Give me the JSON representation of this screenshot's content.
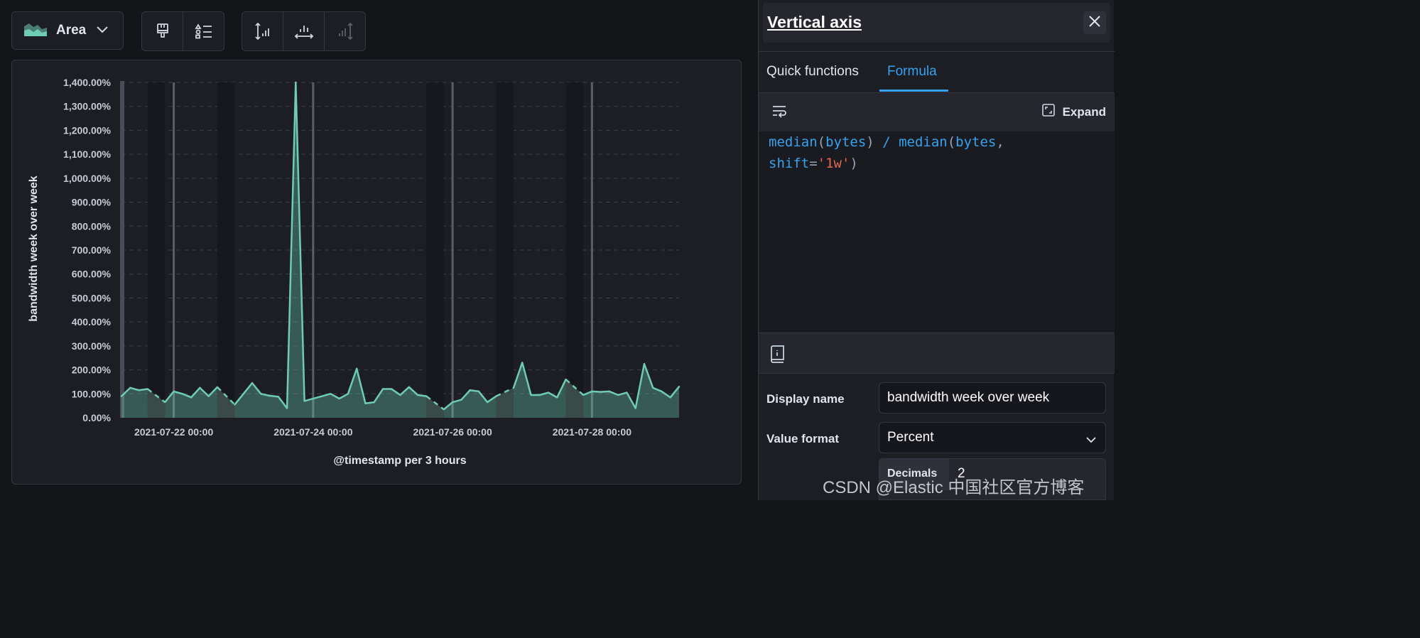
{
  "toolbar": {
    "chart_type_label": "Area",
    "chart_type_icon": "area-chart-icon",
    "style_buttons": [
      "paintbrush-icon",
      "legend-list-icon"
    ],
    "axis_buttons": [
      "left-axis-icon",
      "bottom-axis-icon",
      "right-axis-icon"
    ]
  },
  "chart": {
    "y_axis_title": "bandwidth week over week",
    "x_axis_title": "@timestamp per 3 hours",
    "area_color": "#6dccb1",
    "y_ticks": [
      "0.00%",
      "100.00%",
      "200.00%",
      "300.00%",
      "400.00%",
      "500.00%",
      "600.00%",
      "700.00%",
      "800.00%",
      "900.00%",
      "1,000.00%",
      "1,100.00%",
      "1,200.00%",
      "1,300.00%",
      "1,400.00%"
    ],
    "x_ticks": [
      "2021-07-22 00:00",
      "2021-07-24 00:00",
      "2021-07-26 00:00",
      "2021-07-28 00:00"
    ]
  },
  "chart_data": {
    "type": "area",
    "x_unit": "3-hour buckets from 2021-07-21 06:00",
    "xlabel": "@timestamp per 3 hours",
    "ylabel": "bandwidth week over week",
    "ylim": [
      0,
      1400
    ],
    "y_format": "percent",
    "grid": "horizontal dashed",
    "x": [
      0,
      1,
      2,
      3,
      4,
      5,
      6,
      7,
      8,
      9,
      10,
      11,
      12,
      13,
      14,
      15,
      16,
      17,
      18,
      19,
      20,
      21,
      22,
      23,
      24,
      25,
      26,
      27,
      28,
      29,
      30,
      31,
      32,
      33,
      34,
      35,
      36,
      37,
      38,
      39,
      40,
      41,
      42,
      43,
      44,
      45,
      46,
      47,
      48,
      49,
      50,
      51,
      52,
      53,
      54,
      55,
      56,
      57,
      58,
      59,
      60,
      61,
      62,
      63,
      64
    ],
    "values": [
      90,
      125,
      115,
      120,
      null,
      65,
      110,
      100,
      85,
      125,
      90,
      128,
      null,
      55,
      100,
      145,
      100,
      92,
      88,
      40,
      1400,
      70,
      80,
      90,
      100,
      80,
      100,
      205,
      60,
      65,
      120,
      120,
      95,
      128,
      95,
      90,
      null,
      35,
      65,
      75,
      115,
      110,
      65,
      90,
      null,
      125,
      230,
      95,
      95,
      105,
      85,
      160,
      null,
      95,
      110,
      108,
      110,
      95,
      105,
      40,
      225,
      125,
      110,
      85,
      130
    ],
    "dashed_gaps_after": [
      3,
      11,
      35,
      43,
      51
    ]
  },
  "flyout": {
    "title": "Vertical axis",
    "tabs": [
      {
        "label": "Quick functions",
        "active": false
      },
      {
        "label": "Formula",
        "active": true
      }
    ],
    "expand_label": "Expand",
    "formula": "median(bytes) / median(bytes, shift='1w')",
    "formula_lines": [
      [
        {
          "t": "median",
          "c": "fn"
        },
        {
          "t": "(",
          "c": "p"
        },
        {
          "t": "bytes",
          "c": "fn"
        },
        {
          "t": ")",
          "c": "p"
        },
        {
          "t": " / ",
          "c": "op"
        },
        {
          "t": "median",
          "c": "fn"
        },
        {
          "t": "(",
          "c": "p"
        },
        {
          "t": "bytes",
          "c": "fn"
        },
        {
          "t": ",",
          "c": "p"
        }
      ],
      [
        {
          "t": "shift",
          "c": "kw"
        },
        {
          "t": "=",
          "c": "p"
        },
        {
          "t": "'1w'",
          "c": "str"
        },
        {
          "t": ")",
          "c": "p"
        }
      ]
    ],
    "display_name_label": "Display name",
    "display_name_value": "bandwidth week over week",
    "value_format_label": "Value format",
    "value_format_value": "Percent",
    "decimals_label": "Decimals",
    "decimals_value": "2"
  },
  "watermark": "CSDN @Elastic 中国社区官方博客"
}
